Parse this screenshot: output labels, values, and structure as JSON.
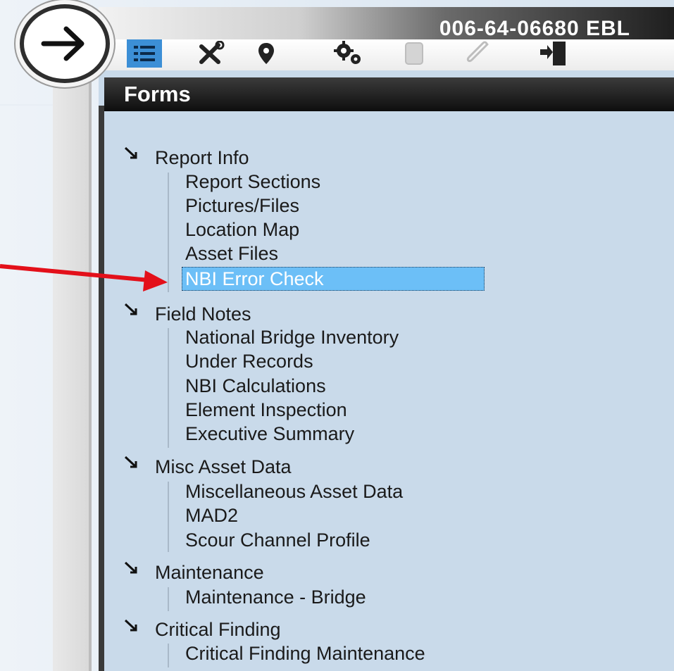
{
  "header": {
    "asset_id": "006-64-06680 EBL"
  },
  "toolbar": {
    "icons": [
      "list-icon",
      "tools-icon",
      "location-pin-icon",
      "gears-icon",
      "document-icon",
      "paperclip-icon",
      "exit-icon"
    ]
  },
  "panel": {
    "title": "Forms"
  },
  "tree": [
    {
      "label": "Report Info",
      "items": [
        "Report Sections",
        "Pictures/Files",
        "Location Map",
        "Asset Files",
        "NBI Error Check"
      ]
    },
    {
      "label": "Field Notes",
      "items": [
        "National Bridge Inventory",
        "Under Records",
        "NBI Calculations",
        "Element Inspection",
        "Executive Summary"
      ]
    },
    {
      "label": "Misc Asset Data",
      "items": [
        "Miscellaneous Asset Data",
        "MAD2",
        "Scour Channel Profile"
      ]
    },
    {
      "label": "Maintenance",
      "items": [
        "Maintenance - Bridge"
      ]
    },
    {
      "label": "Critical Finding",
      "items": [
        "Critical Finding Maintenance"
      ]
    }
  ],
  "selected_item": "NBI Error Check",
  "colors": {
    "panel_bg": "#c9daea",
    "selection": "#6cbff7",
    "annotation_arrow": "#e3101a"
  }
}
